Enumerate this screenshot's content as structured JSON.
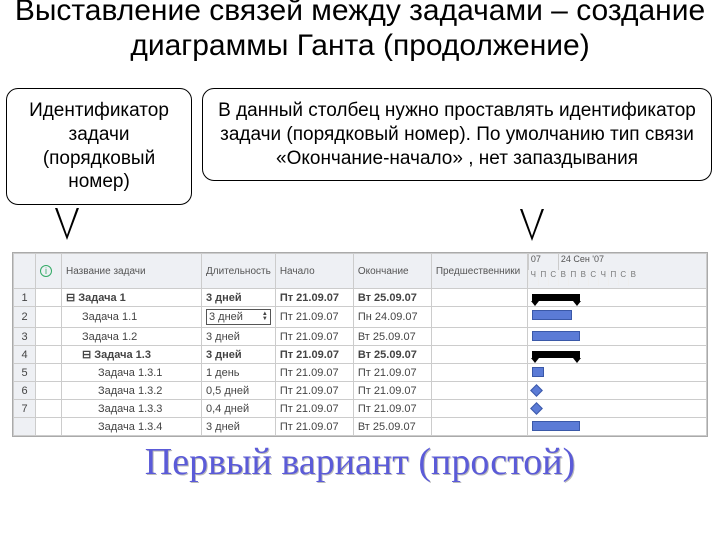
{
  "title": "Выставление связей между задачами – создание диаграммы Ганта (продолжение)",
  "callouts": {
    "left": "Идентификатор задачи (порядковый номер)",
    "right": "В данный столбец нужно проставлять идентификатор задачи (порядковый номер). По умолчанию тип связи «Окончание-начало» , нет запаздывания"
  },
  "table": {
    "headers": {
      "info": "",
      "name": "Название задачи",
      "dur": "Длительность",
      "start": "Начало",
      "end": "Окончание",
      "pred": "Предшественники"
    },
    "gantt_header": {
      "w1": "07",
      "w2": "24 Сен '07",
      "days": [
        "Ч",
        "П",
        "С",
        "В",
        "П",
        "В",
        "С",
        "Ч",
        "П",
        "С",
        "В"
      ]
    },
    "rows": [
      {
        "id": "1",
        "name": "Задача 1",
        "dur": "3 дней",
        "start": "Пт 21.09.07",
        "end": "Вт 25.09.07",
        "summary": true,
        "indent": 0,
        "bar": {
          "type": "sum",
          "l": 4,
          "w": 48
        }
      },
      {
        "id": "2",
        "name": "Задача 1.1",
        "dur": "3 дней",
        "start": "Пт 21.09.07",
        "end": "Пн 24.09.07",
        "summary": false,
        "indent": 1,
        "editable": true,
        "bar": {
          "type": "task",
          "l": 4,
          "w": 40
        }
      },
      {
        "id": "3",
        "name": "Задача 1.2",
        "dur": "3 дней",
        "start": "Пт 21.09.07",
        "end": "Вт 25.09.07",
        "summary": false,
        "indent": 1,
        "bar": {
          "type": "task",
          "l": 4,
          "w": 48
        }
      },
      {
        "id": "4",
        "name": "Задача 1.3",
        "dur": "3 дней",
        "start": "Пт 21.09.07",
        "end": "Вт 25.09.07",
        "summary": true,
        "indent": 1,
        "bar": {
          "type": "sum",
          "l": 4,
          "w": 48
        }
      },
      {
        "id": "5",
        "name": "Задача 1.3.1",
        "dur": "1 день",
        "start": "Пт 21.09.07",
        "end": "Пт 21.09.07",
        "summary": false,
        "indent": 2,
        "bar": {
          "type": "task",
          "l": 4,
          "w": 12
        }
      },
      {
        "id": "6",
        "name": "Задача 1.3.2",
        "dur": "0,5 дней",
        "start": "Пт 21.09.07",
        "end": "Пт 21.09.07",
        "summary": false,
        "indent": 2,
        "bar": {
          "type": "mile",
          "l": 4
        }
      },
      {
        "id": "7",
        "name": "Задача 1.3.3",
        "dur": "0,4 дней",
        "start": "Пт 21.09.07",
        "end": "Пт 21.09.07",
        "summary": false,
        "indent": 2,
        "bar": {
          "type": "mile",
          "l": 4
        }
      },
      {
        "id": "",
        "name": "Задача 1.3.4",
        "dur": "3 дней",
        "start": "Пт 21.09.07",
        "end": "Вт 25.09.07",
        "summary": false,
        "indent": 2,
        "bar": {
          "type": "task",
          "l": 4,
          "w": 48
        }
      }
    ]
  },
  "subtitle": "Первый вариант (простой)"
}
